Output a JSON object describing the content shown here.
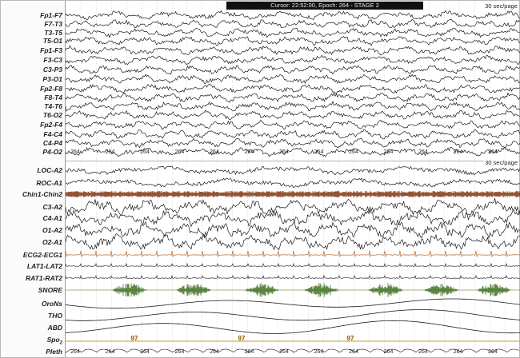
{
  "status": {
    "cursor_text": "Cursor: 22:52:00, Epoch: 264 - STAGE 2"
  },
  "page_scale": {
    "top": "30 sec/page",
    "bottom": "30 sec/page"
  },
  "channels": [
    {
      "label": "Fp1-F7"
    },
    {
      "label": "F7-T3"
    },
    {
      "label": "T3-T5"
    },
    {
      "label": "T5-O1"
    },
    {
      "label": "Fp1-F3"
    },
    {
      "label": "F3-C3"
    },
    {
      "label": "C3-P3"
    },
    {
      "label": "P3-O1"
    },
    {
      "label": "Fp2-F8"
    },
    {
      "label": "F8-T4"
    },
    {
      "label": "T4-T6"
    },
    {
      "label": "T6-O2"
    },
    {
      "label": "Fp2-F4"
    },
    {
      "label": "F4-C4"
    },
    {
      "label": "C4-P4"
    },
    {
      "label": "P4-O2"
    },
    {
      "label": "LOC-A2"
    },
    {
      "label": "ROC-A1"
    },
    {
      "label": "Chin1-Chin2"
    },
    {
      "label": "C3-A2"
    },
    {
      "label": "C4-A1"
    },
    {
      "label": "O1-A2"
    },
    {
      "label": "O2-A1"
    },
    {
      "label": "ECG2-ECG1"
    },
    {
      "label": "LAT1-LAT2"
    },
    {
      "label": "RAT1-RAT2"
    },
    {
      "label": "SNORE"
    },
    {
      "label": "OroNs"
    },
    {
      "label": "THO"
    },
    {
      "label": "ABD"
    },
    {
      "label": "Spo",
      "sub": "2"
    },
    {
      "label": "Pleth"
    }
  ],
  "epoch_markers": {
    "eeg_row": [
      "264",
      "264",
      "264",
      "264",
      "264",
      "264",
      "264",
      "264",
      "264",
      "264",
      "264",
      "264",
      "264"
    ],
    "pleth_row": [
      "264",
      "264",
      "264",
      "264",
      "264",
      "264",
      "264",
      "264",
      "264",
      "264",
      "264",
      "264",
      "264"
    ]
  },
  "spo2_values": [
    "97",
    "97",
    "97"
  ],
  "colors": {
    "trace": "#1a1a1a",
    "emg": "#7a2a00",
    "ecg": "#b8692c",
    "snore": "#3a6b1a",
    "spo2": "#c89a2a",
    "grid": "#c8c8c8",
    "status_bg": "#101010"
  }
}
